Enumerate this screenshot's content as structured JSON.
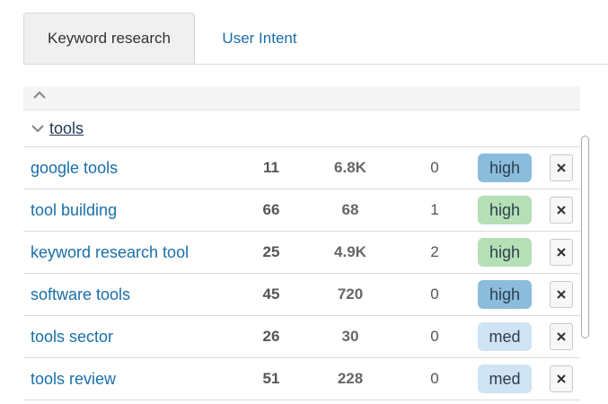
{
  "tabs": [
    {
      "label": "Keyword research",
      "active": true
    },
    {
      "label": "User Intent",
      "active": false
    }
  ],
  "group": {
    "title": "tools"
  },
  "rows": [
    {
      "keyword": "google tools",
      "c1": "11",
      "c2": "6.8K",
      "c3": "0",
      "badge": "high",
      "badge_color": "#8bbcdb"
    },
    {
      "keyword": "tool building",
      "c1": "66",
      "c2": "68",
      "c3": "1",
      "badge": "high",
      "badge_color": "#b5dfb5"
    },
    {
      "keyword": "keyword research tool",
      "c1": "25",
      "c2": "4.9K",
      "c3": "2",
      "badge": "high",
      "badge_color": "#b5dfb5"
    },
    {
      "keyword": "software tools",
      "c1": "45",
      "c2": "720",
      "c3": "0",
      "badge": "high",
      "badge_color": "#8bbcdb"
    },
    {
      "keyword": "tools sector",
      "c1": "26",
      "c2": "30",
      "c3": "0",
      "badge": "med",
      "badge_color": "#cfe3f2"
    },
    {
      "keyword": "tools review",
      "c1": "51",
      "c2": "228",
      "c3": "0",
      "badge": "med",
      "badge_color": "#cfe3f2"
    }
  ],
  "icons": {
    "collapse": "chevron-up-icon",
    "expand": "chevron-down-icon",
    "remove": "close-icon"
  }
}
